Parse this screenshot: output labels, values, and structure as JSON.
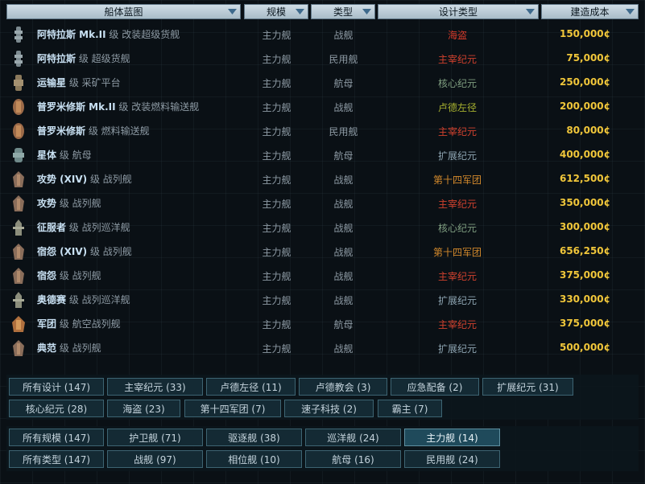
{
  "columns": [
    {
      "key": "blueprint",
      "label": "船体蓝图"
    },
    {
      "key": "size",
      "label": "规模"
    },
    {
      "key": "type",
      "label": "类型"
    },
    {
      "key": "design",
      "label": "设计类型"
    },
    {
      "key": "cost",
      "label": "建造成本"
    }
  ],
  "rows": [
    {
      "cls": "阿特拉斯 Mk.II",
      "rest": "级 改装超级货舰",
      "size": "主力舰",
      "type": "战舰",
      "design": "海盗",
      "design_color": "#d43a2a",
      "cost": "150,000¢",
      "icon": "cargo-ship-icon"
    },
    {
      "cls": "阿特拉斯",
      "rest": "级 超级货舰",
      "size": "主力舰",
      "type": "民用舰",
      "design": "主宰纪元",
      "design_color": "#d0412e",
      "cost": "75,000¢",
      "icon": "cargo-ship-icon"
    },
    {
      "cls": "运输星",
      "rest": "级 采矿平台",
      "size": "主力舰",
      "type": "航母",
      "design": "核心纪元",
      "design_color": "#7f9e80",
      "cost": "250,000¢",
      "icon": "mining-platform-icon"
    },
    {
      "cls": "普罗米修斯 Mk.II",
      "rest": "级 改装燃料输送舰",
      "size": "主力舰",
      "type": "战舰",
      "design": "卢德左径",
      "design_color": "#a6b02f",
      "cost": "200,000¢",
      "icon": "tanker-ship-icon"
    },
    {
      "cls": "普罗米修斯",
      "rest": "级 燃料输送舰",
      "size": "主力舰",
      "type": "民用舰",
      "design": "主宰纪元",
      "design_color": "#d0412e",
      "cost": "80,000¢",
      "icon": "tanker-ship-icon"
    },
    {
      "cls": "星体",
      "rest": "级 航母",
      "size": "主力舰",
      "type": "航母",
      "design": "扩展纪元",
      "design_color": "#8ea5b2",
      "cost": "400,000¢",
      "icon": "carrier-ship-icon"
    },
    {
      "cls": "攻势 (XIV)",
      "rest": "级 战列舰",
      "size": "主力舰",
      "type": "战舰",
      "design": "第十四军团",
      "design_color": "#d2892c",
      "cost": "612,500¢",
      "icon": "battleship-icon"
    },
    {
      "cls": "攻势",
      "rest": "级 战列舰",
      "size": "主力舰",
      "type": "战舰",
      "design": "主宰纪元",
      "design_color": "#d0412e",
      "cost": "350,000¢",
      "icon": "battleship-icon"
    },
    {
      "cls": "征服者",
      "rest": "级 战列巡洋舰",
      "size": "主力舰",
      "type": "战舰",
      "design": "核心纪元",
      "design_color": "#7f9e80",
      "cost": "300,000¢",
      "icon": "battlecruiser-icon"
    },
    {
      "cls": "宿怨 (XIV)",
      "rest": "级 战列舰",
      "size": "主力舰",
      "type": "战舰",
      "design": "第十四军团",
      "design_color": "#d2892c",
      "cost": "656,250¢",
      "icon": "battleship-icon"
    },
    {
      "cls": "宿怨",
      "rest": "级 战列舰",
      "size": "主力舰",
      "type": "战舰",
      "design": "主宰纪元",
      "design_color": "#d0412e",
      "cost": "375,000¢",
      "icon": "battleship-icon"
    },
    {
      "cls": "奥德赛",
      "rest": "级 战列巡洋舰",
      "size": "主力舰",
      "type": "战舰",
      "design": "扩展纪元",
      "design_color": "#8ea5b2",
      "cost": "330,000¢",
      "icon": "battlecruiser-icon"
    },
    {
      "cls": "军团",
      "rest": "级 航空战列舰",
      "size": "主力舰",
      "type": "航母",
      "design": "主宰纪元",
      "design_color": "#d0412e",
      "cost": "375,000¢",
      "icon": "carrier-battleship-icon"
    },
    {
      "cls": "典范",
      "rest": "级 战列舰",
      "size": "主力舰",
      "type": "战舰",
      "design": "扩展纪元",
      "design_color": "#8ea5b2",
      "cost": "500,000¢",
      "icon": "battleship-icon"
    }
  ],
  "filters": {
    "design": [
      "所有设计 (147)",
      "主宰纪元 (33)",
      "卢德左径 (11)",
      "卢德教会 (3)",
      "应急配备 (2)",
      "扩展纪元 (31)",
      "核心纪元 (28)",
      "海盗 (23)",
      "第十四军团 (7)",
      "速子科技 (2)",
      "霸主 (7)"
    ],
    "size": [
      "所有规模 (147)",
      "护卫舰 (71)",
      "驱逐舰 (38)",
      "巡洋舰 (24)",
      "主力舰 (14)"
    ],
    "type": [
      "所有类型 (147)",
      "战舰 (97)",
      "相位舰 (10)",
      "航母 (16)",
      "民用舰 (24)"
    ]
  },
  "selected": {
    "size": "主力舰 (14)"
  },
  "colors": {
    "header_bg": "#bfd0db",
    "cost": "#f0c63a",
    "button_bg": "#142a34",
    "button_sel": "#1f4a5b"
  }
}
